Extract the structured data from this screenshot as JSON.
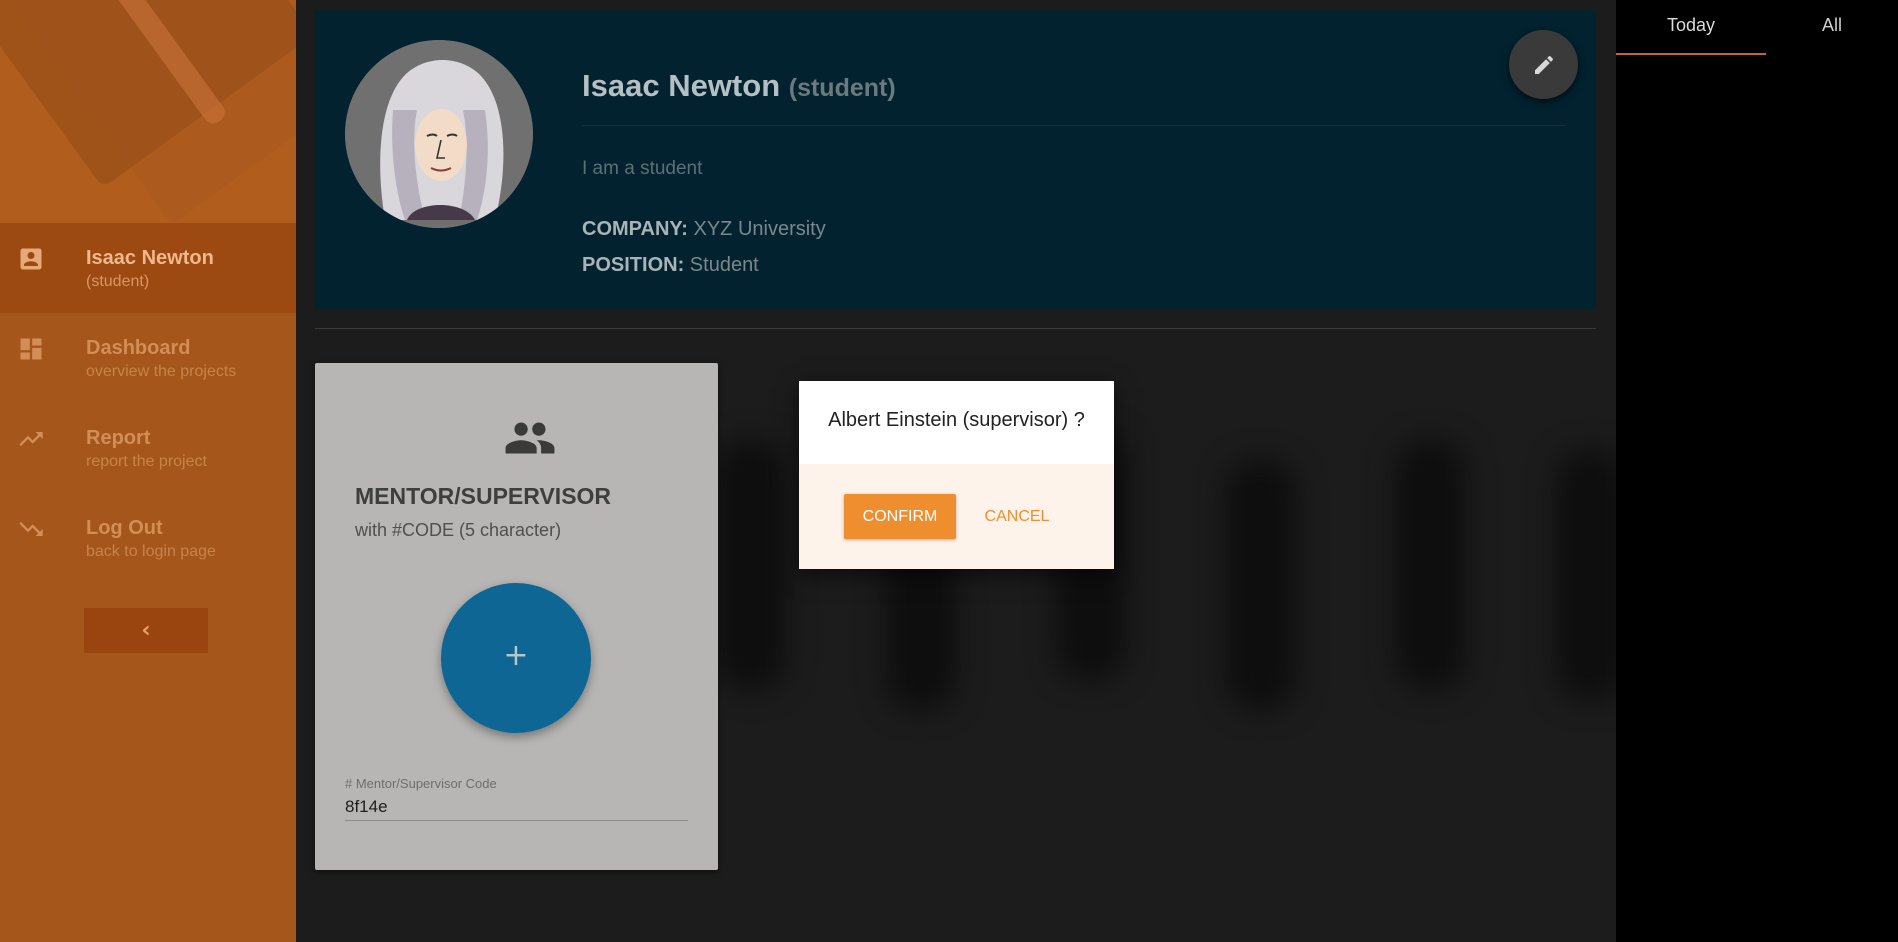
{
  "sidebar": {
    "items": [
      {
        "title": "Isaac Newton",
        "subtitle": "(student)",
        "icon": "contact-card-icon",
        "active": true
      },
      {
        "title": "Dashboard",
        "subtitle": "overview the projects",
        "icon": "dashboard-icon"
      },
      {
        "title": "Report",
        "subtitle": "report the project",
        "icon": "trending-up-icon"
      },
      {
        "title": "Log Out",
        "subtitle": "back to login page",
        "icon": "logout-arrow-icon"
      }
    ],
    "collapse_label": "‹"
  },
  "profile": {
    "name": "Isaac Newton",
    "role": "(student)",
    "bio": "I am a student",
    "company_label": "COMPANY:",
    "company": "XYZ University",
    "position_label": "POSITION:",
    "position": "Student"
  },
  "mentor": {
    "title": "MENTOR/SUPERVISOR",
    "subtitle": "with #CODE (5 character)",
    "add_label": "+",
    "code_label": "# Mentor/Supervisor Code",
    "code_value": "8f14e"
  },
  "tabs": [
    {
      "label": "Today",
      "active": true
    },
    {
      "label": "All"
    }
  ],
  "dialog": {
    "message": "Albert Einstein (supervisor) ?",
    "confirm_label": "CONFIRM",
    "cancel_label": "CANCEL"
  },
  "colors": {
    "sidebar": "#a4561b",
    "accent": "#ef8e2f",
    "profile_bg": "#02222f",
    "fab_blue": "#0e6695"
  }
}
